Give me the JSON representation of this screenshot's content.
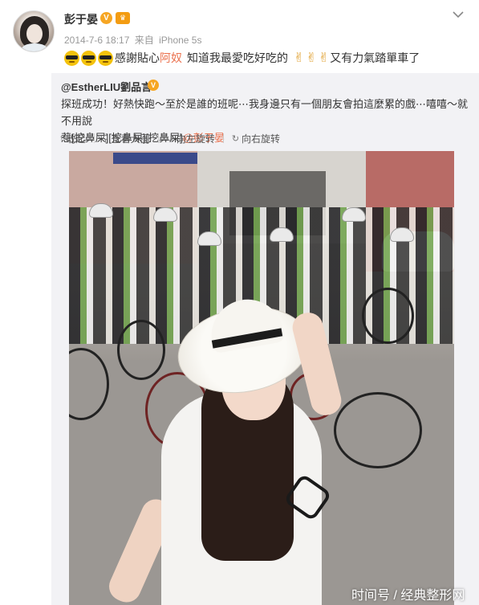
{
  "post": {
    "author": {
      "name": "彭于晏",
      "verified_badge": "V",
      "member_badge": "♛"
    },
    "meta": {
      "date": "2014-7-6 18:17",
      "source_prefix": "来自",
      "source": "iPhone 5s"
    },
    "status": {
      "emoji_icons": [
        "cool-emoji",
        "cool-emoji",
        "cool-emoji"
      ],
      "text_1": "感謝貼心",
      "mention": "阿奴",
      "text_2": "知道我最愛吃好吃的",
      "hand_icons": [
        "victory-hand",
        "victory-hand",
        "rock-hand"
      ],
      "text_3": "又有力氣踏單車了"
    }
  },
  "repost": {
    "user": "@EstherLIU劉品言",
    "verified_badge": "V",
    "text_line1": "探班成功！好熱快跑～至於是誰的班呢⋯我身邊只有一個朋友會拍這麼累的戲⋯嘻嘻～就不用說",
    "text_line2": "惹[挖鼻屎][挖鼻屎][挖鼻屎]",
    "mention": "@彭于晏",
    "toolbar": {
      "collapse": "收起",
      "view_large": "查看大图",
      "rotate_left": "向左旋转",
      "rotate_right": "向右旋转"
    }
  },
  "watermark": "时间号 / 经典整形网",
  "colors": {
    "mention": "#eb7350",
    "verified": "#f6a623",
    "repost_bg": "#f2f2f5",
    "meta_text": "#999999"
  },
  "icons": {
    "header_menu": "chevron-down-icon",
    "collapse": "arrow-up-icon",
    "view_large": "magnifier-icon",
    "rotate_left": "rotate-left-icon",
    "rotate_right": "rotate-right-icon"
  }
}
